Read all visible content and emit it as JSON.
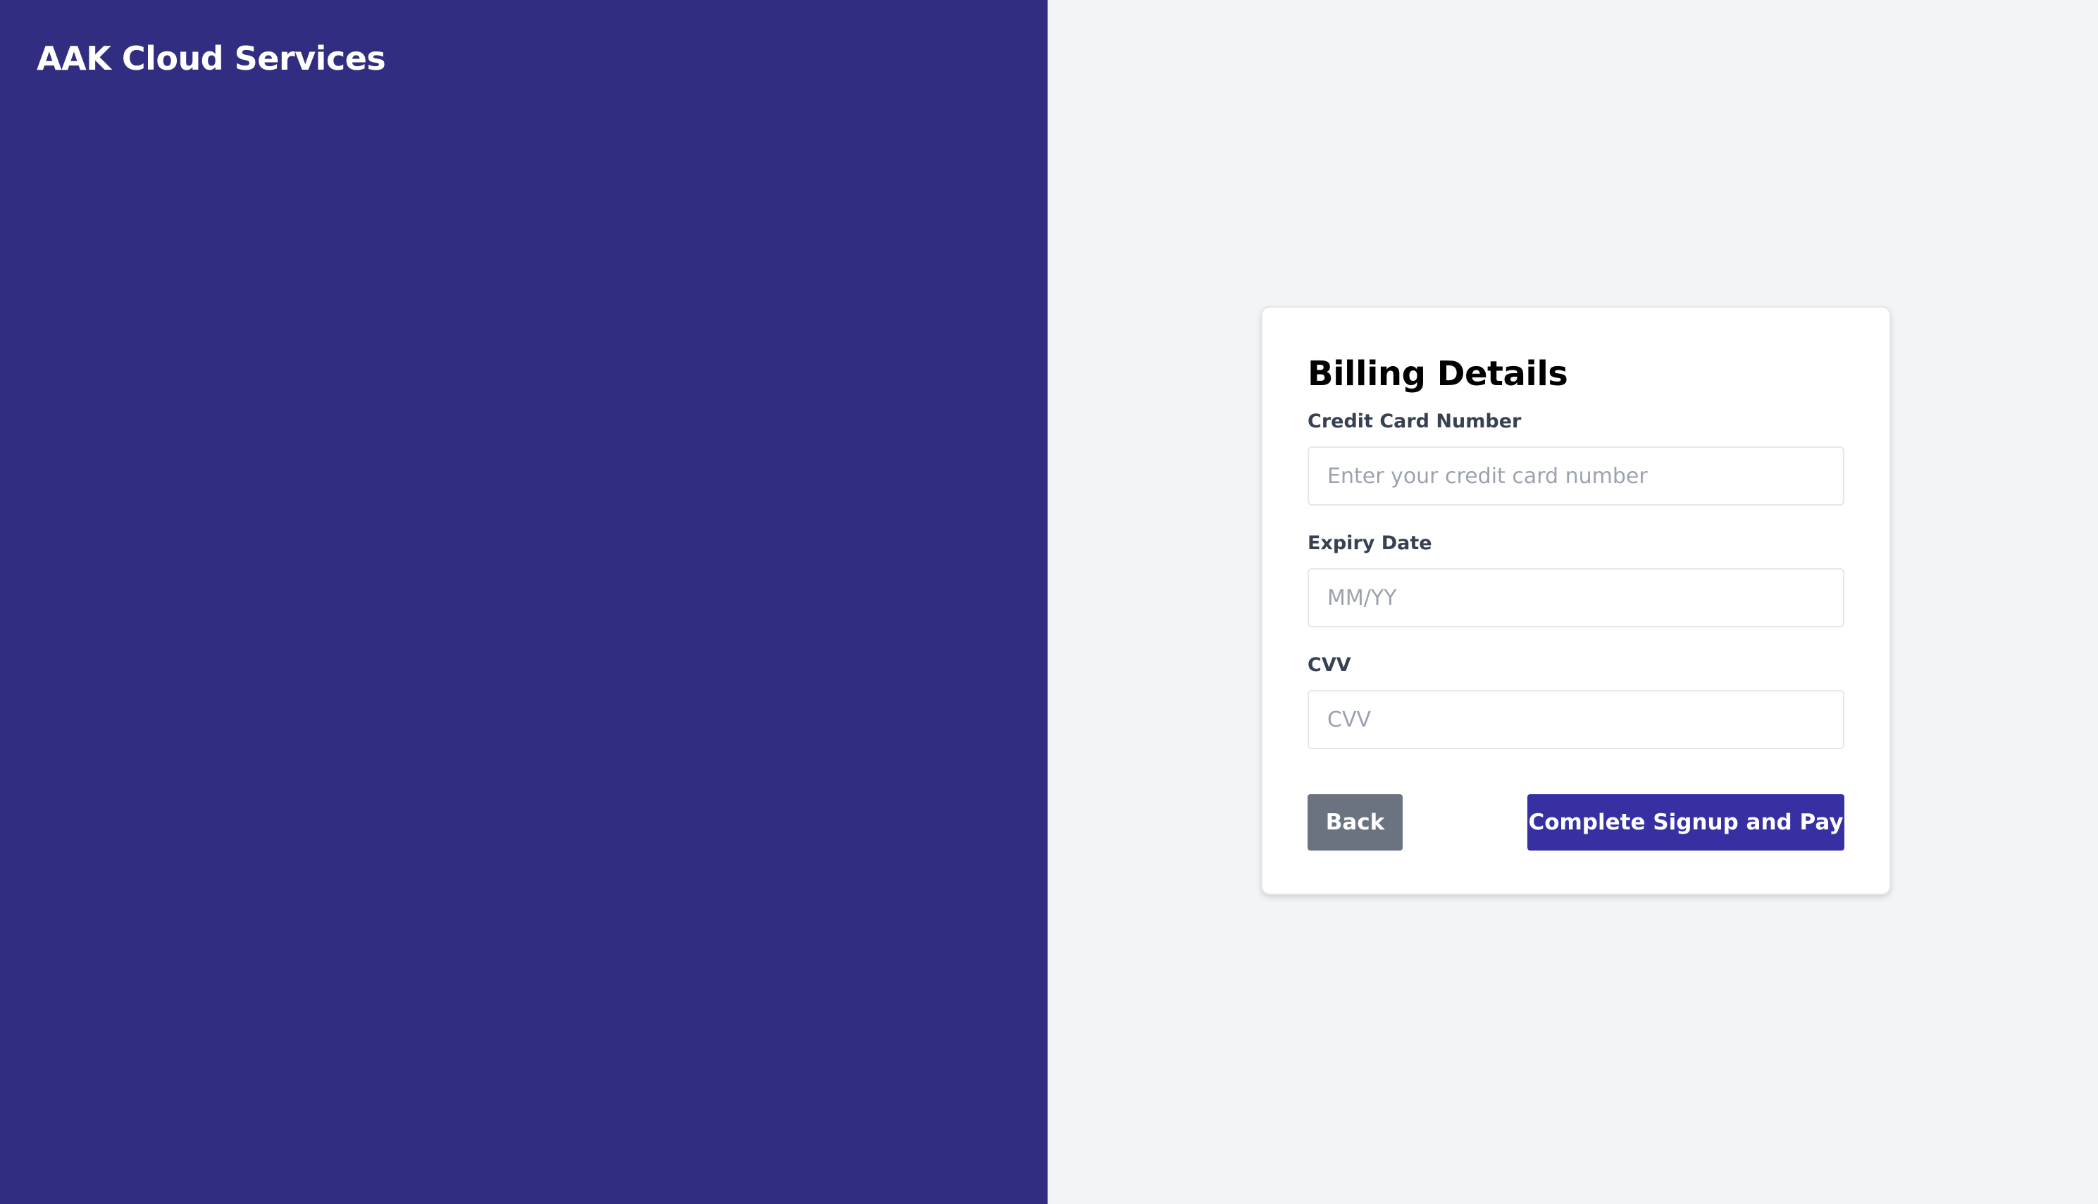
{
  "brand": {
    "name": "AAK Cloud Services"
  },
  "billing_form": {
    "title": "Billing Details",
    "card_number": {
      "label": "Credit Card Number",
      "value": "",
      "placeholder": "Enter your credit card number"
    },
    "expiry": {
      "label": "Expiry Date",
      "value": "",
      "placeholder": "MM/YY"
    },
    "cvv": {
      "label": "CVV",
      "value": "",
      "placeholder": "CVV"
    },
    "back_label": "Back",
    "submit_label": "Complete Signup and Pay"
  },
  "colors": {
    "brand_panel": "#312e81",
    "page_background": "#f3f4f6",
    "primary_button": "#3730a3",
    "secondary_button": "#6b7280"
  }
}
